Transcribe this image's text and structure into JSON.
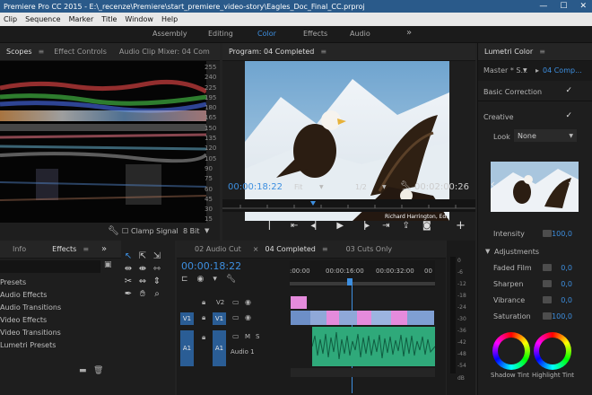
{
  "title_bar": {
    "text": "Premiere Pro CC 2015 - E:\\_recenze\\Premiere\\start_premiere_video-story\\Eagles_Doc_Final_CC.prproj",
    "minimize": "—",
    "maximize": "☐",
    "close": "✕"
  },
  "menu": [
    "Clip",
    "Sequence",
    "Marker",
    "Title",
    "Window",
    "Help"
  ],
  "workspaces": {
    "items": [
      "Assembly",
      "Editing",
      "Color",
      "Effects",
      "Audio"
    ],
    "active": "Color",
    "more": "»"
  },
  "scopes_panel": {
    "tabs": [
      "Scopes",
      "Effect Controls",
      "Audio Clip Mixer: 04 Com"
    ],
    "scale": [
      "255",
      "240",
      "225",
      "195",
      "180",
      "165",
      "150",
      "135",
      "120",
      "105",
      "90",
      "75",
      "60",
      "45",
      "30",
      "15",
      "0"
    ],
    "clamp_label": "Clamp Signal",
    "bit_depth": "8 Bit"
  },
  "program_monitor": {
    "title": "Program: 04 Completed",
    "timecode_left": "00:00:18:22",
    "fit": "Fit",
    "resolution": "1/2",
    "timecode_right": "00:02:00:26",
    "caption": "Richard Harrington, Ed."
  },
  "lumetri": {
    "title": "Lumetri Color",
    "master": "Master * S...",
    "sequence": "04 Comp...",
    "basic_correction": "Basic Correction",
    "creative": "Creative",
    "look_label": "Look",
    "look_value": "None",
    "intensity_label": "Intensity",
    "intensity_value": "100,0",
    "adjustments": "Adjustments",
    "faded_film": {
      "label": "Faded Film",
      "value": "0,0"
    },
    "sharpen": {
      "label": "Sharpen",
      "value": "0,0"
    },
    "vibrance": {
      "label": "Vibrance",
      "value": "0,0"
    },
    "saturation": {
      "label": "Saturation",
      "value": "100,0"
    },
    "wheel_labels": [
      "Shadow Tint",
      "Highlight Tint"
    ]
  },
  "effects_panel": {
    "tabs": [
      "Info",
      "Effects"
    ],
    "more": "»",
    "items": [
      "Presets",
      "Audio Effects",
      "Audio Transitions",
      "Video Effects",
      "Video Transitions",
      "Lumetri Presets"
    ]
  },
  "timeline": {
    "tabs": [
      "02 Audio Cut",
      "04 Completed",
      "03 Cuts Only"
    ],
    "close": "×",
    "more": "»",
    "timecode": "00:00:18:22",
    "ruler": [
      ":00:00",
      "00:00:16:00",
      "00:00:32:00",
      "00"
    ],
    "tracks": {
      "v2": "V2",
      "v1": "V1",
      "a1": "A1",
      "audio_name": "Audio 1",
      "mute": "M",
      "solo": "S"
    }
  },
  "meter": {
    "labels": [
      "0",
      "-6",
      "-12",
      "-18",
      "-24",
      "-30",
      "-36",
      "-42",
      "-48",
      "-54"
    ],
    "db": "dB"
  }
}
